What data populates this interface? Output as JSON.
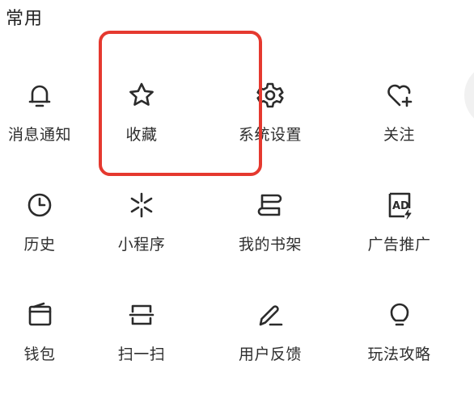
{
  "section": {
    "title": "常用"
  },
  "items": [
    {
      "label": "消息通知",
      "icon": "bell-icon"
    },
    {
      "label": "收藏",
      "icon": "star-icon"
    },
    {
      "label": "系统设置",
      "icon": "gear-icon"
    },
    {
      "label": "关注",
      "icon": "heart-plus-icon"
    },
    {
      "label": "历史",
      "icon": "clock-icon"
    },
    {
      "label": "小程序",
      "icon": "mini-program-icon"
    },
    {
      "label": "我的书架",
      "icon": "bookshelf-icon"
    },
    {
      "label": "广告推广",
      "icon": "ad-icon"
    },
    {
      "label": "钱包",
      "icon": "wallet-icon"
    },
    {
      "label": "扫一扫",
      "icon": "scan-icon"
    },
    {
      "label": "用户反馈",
      "icon": "feedback-pen-icon"
    },
    {
      "label": "玩法攻略",
      "icon": "lightbulb-icon"
    }
  ],
  "highlight": {
    "color": "#e5392f",
    "target": "收藏"
  }
}
